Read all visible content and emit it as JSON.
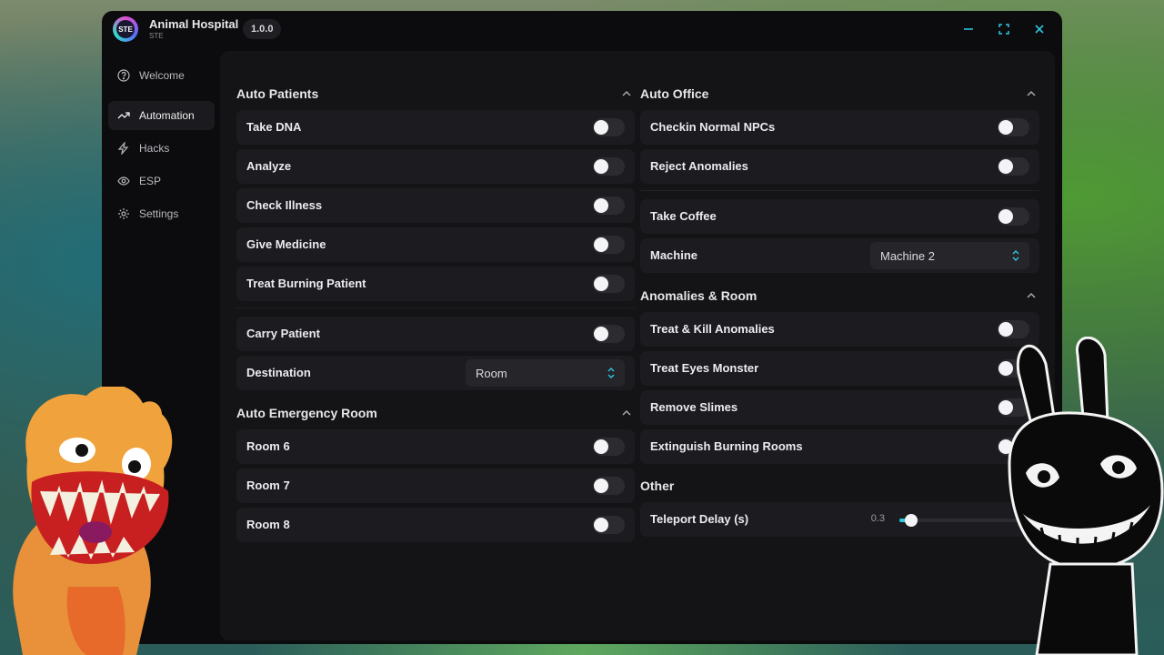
{
  "app": {
    "title": "Animal Hospital",
    "subtitle": "STE",
    "version": "1.0.0",
    "logo_text": "STE",
    "accent": "#2ec9e0"
  },
  "sidebar": {
    "items": [
      {
        "label": "Welcome",
        "icon": "help-circle-icon"
      },
      {
        "label": "Automation",
        "icon": "trend-icon",
        "active": true
      },
      {
        "label": "Hacks",
        "icon": "bolt-icon"
      },
      {
        "label": "ESP",
        "icon": "eye-icon"
      },
      {
        "label": "Settings",
        "icon": "gear-icon"
      }
    ]
  },
  "auto_patients": {
    "title": "Auto Patients",
    "toggles": [
      "Take DNA",
      "Analyze",
      "Check Illness",
      "Give Medicine",
      "Treat Burning Patient"
    ],
    "carry_patient": "Carry Patient",
    "destination": {
      "label": "Destination",
      "value": "Room"
    }
  },
  "auto_emergency": {
    "title": "Auto Emergency Room",
    "toggles": [
      "Room 6",
      "Room 7",
      "Room 8"
    ]
  },
  "auto_office": {
    "title": "Auto Office",
    "toggles": [
      "Checkin Normal NPCs",
      "Reject Anomalies"
    ],
    "take_coffee": "Take Coffee",
    "machine": {
      "label": "Machine",
      "value": "Machine 2"
    }
  },
  "anomalies_room": {
    "title": "Anomalies & Room",
    "toggles": [
      "Treat & Kill Anomalies",
      "Treat Eyes Monster",
      "Remove Slimes",
      "Extinguish Burning Rooms"
    ]
  },
  "other": {
    "title": "Other",
    "teleport_delay": {
      "label": "Teleport Delay (s)",
      "value": "0.3",
      "fraction": 0.1
    }
  }
}
